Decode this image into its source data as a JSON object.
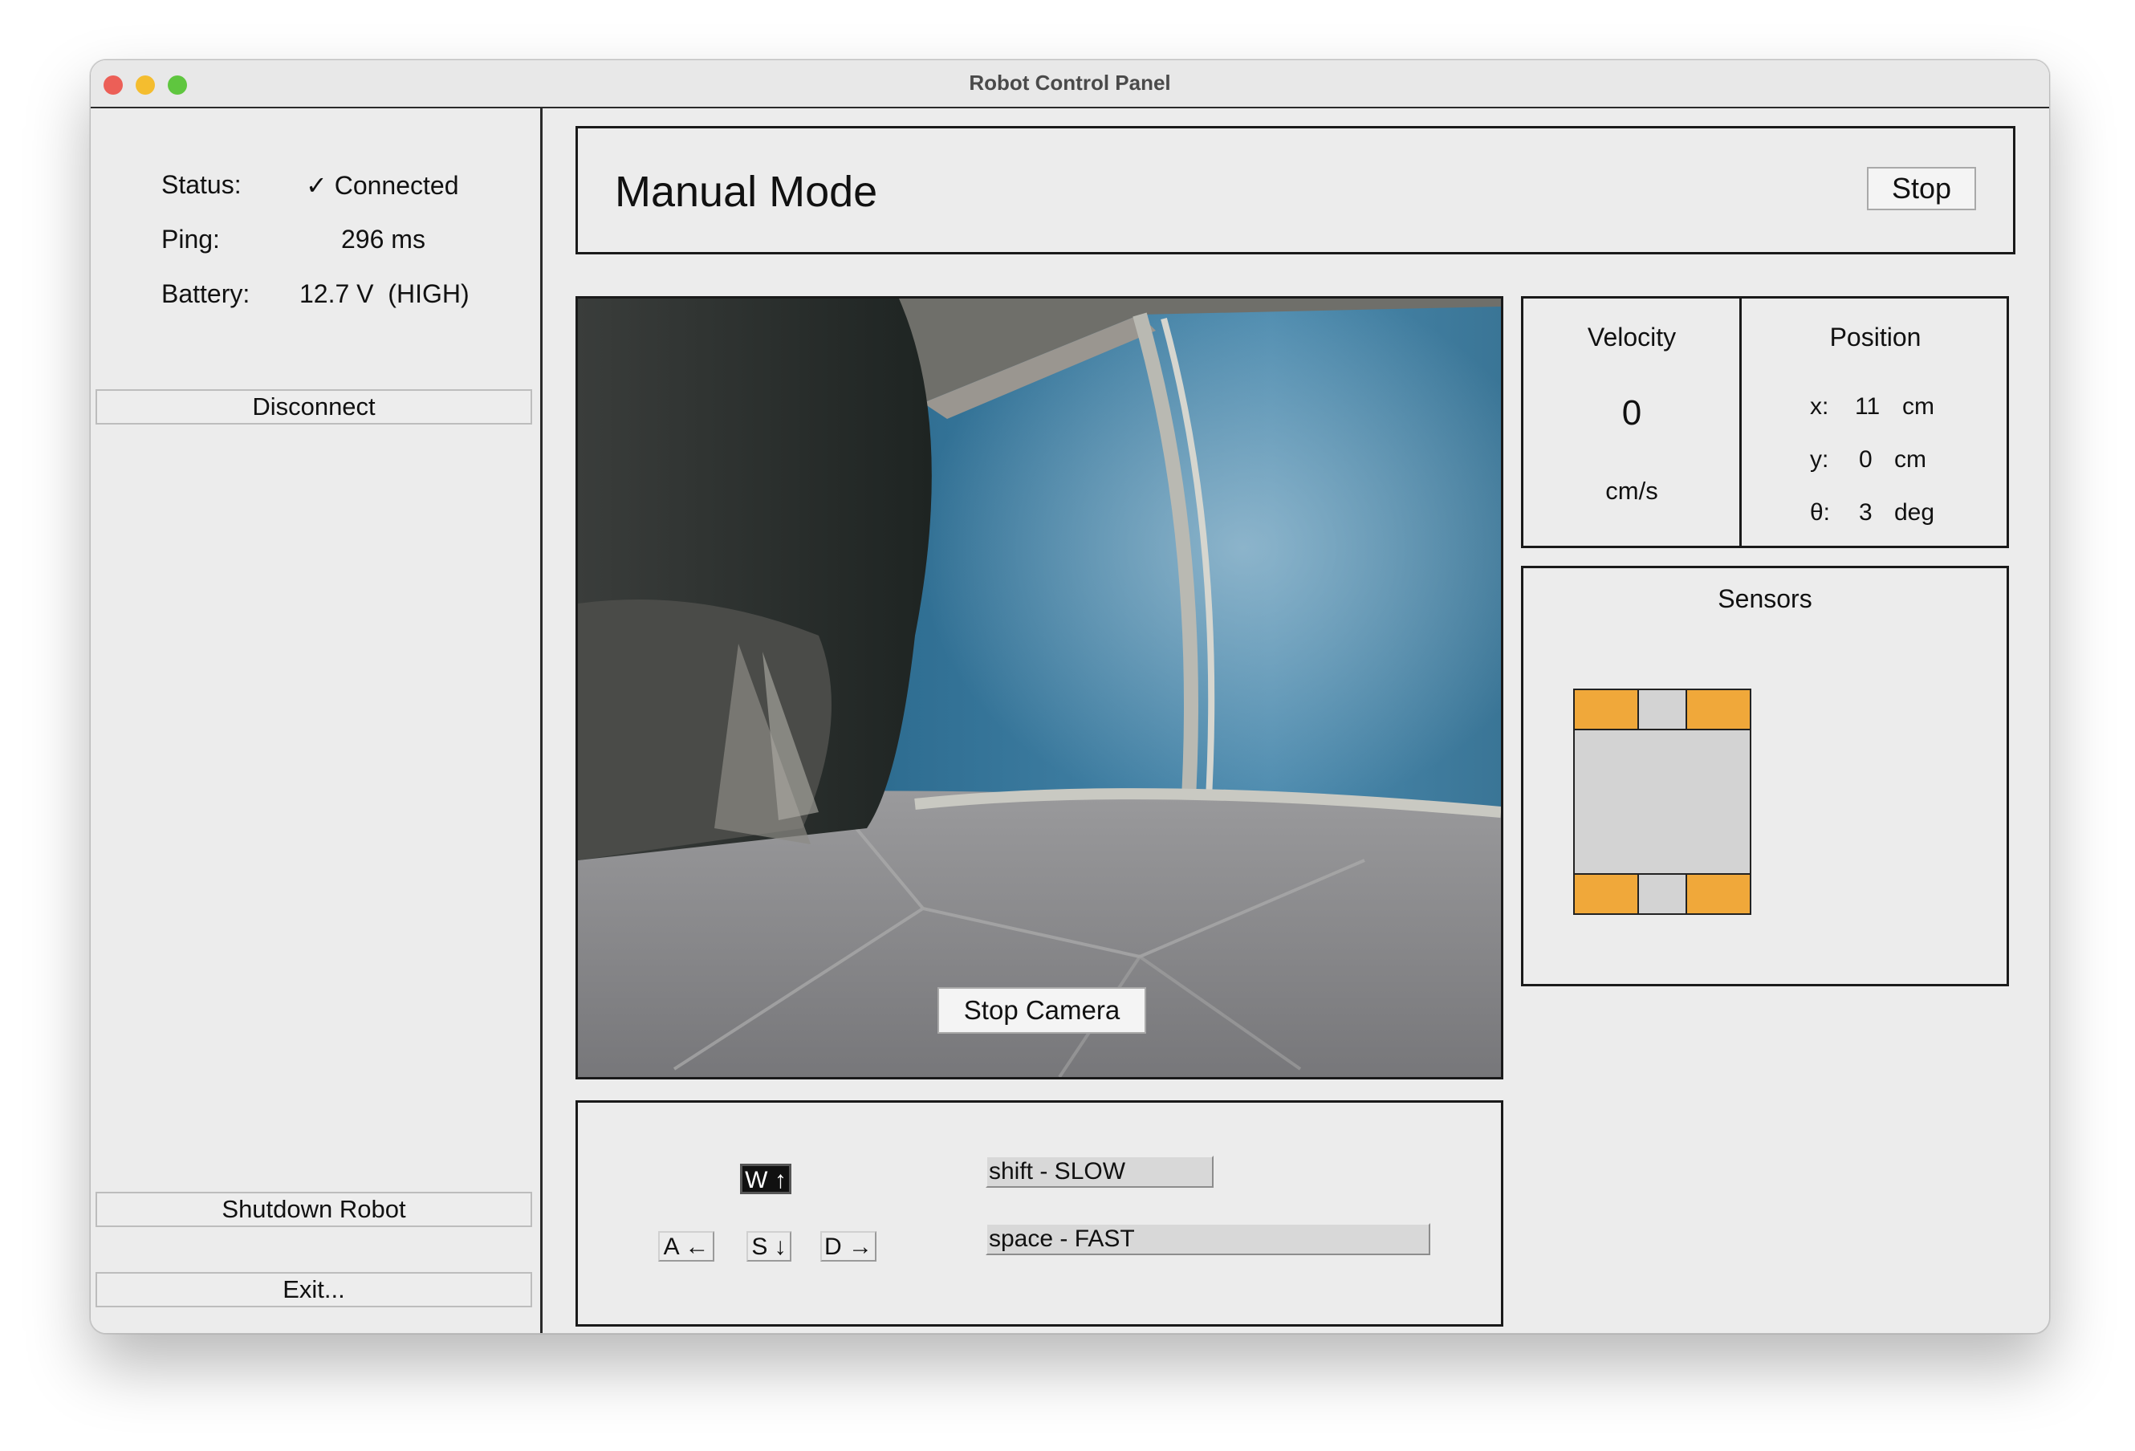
{
  "window": {
    "title": "Robot Control Panel"
  },
  "sidebar": {
    "status_label": "Status:",
    "status_value": "✓ Connected",
    "ping_label": "Ping:",
    "ping_value": "296 ms",
    "battery_label": "Battery:",
    "battery_value": "12.7 V  (HIGH)",
    "disconnect_label": "Disconnect",
    "shutdown_label": "Shutdown Robot",
    "exit_label": "Exit..."
  },
  "mode": {
    "title": "Manual Mode",
    "stop_label": "Stop"
  },
  "camera": {
    "stop_label": "Stop Camera"
  },
  "velocity": {
    "label": "Velocity",
    "value": "0",
    "unit": "cm/s"
  },
  "position": {
    "label": "Position",
    "x_label": "x:",
    "x_value": "11",
    "x_unit": "cm",
    "y_label": "y:",
    "y_value": "0",
    "y_unit": "cm",
    "theta_label": "θ:",
    "theta_value": "3",
    "theta_unit": "deg"
  },
  "sensors": {
    "label": "Sensors",
    "active_color": "#f0a83a",
    "body_color": "#d3d3d3"
  },
  "controls": {
    "keys": {
      "w": "W ↑",
      "a": "A ←",
      "s": "S ↓",
      "d": "D →"
    },
    "slow_label": "shift - SLOW",
    "fast_label": "space - FAST"
  },
  "colors": {
    "wall_blue": "#2f6e92",
    "floor_gray": "#8c8c8e"
  }
}
